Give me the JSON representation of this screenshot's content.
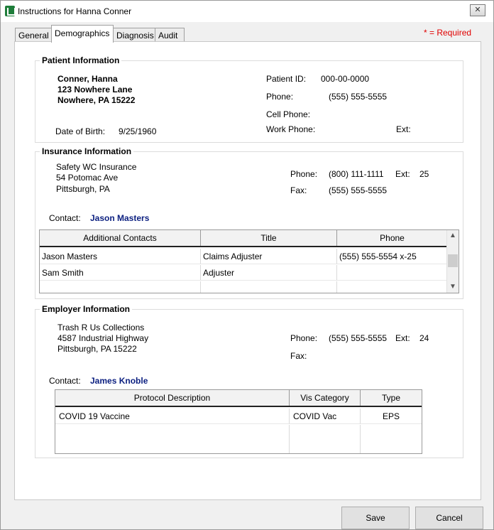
{
  "window": {
    "title": "Instructions for Hanna Conner",
    "close_symbol": "✕"
  },
  "tabs": [
    {
      "label": "General"
    },
    {
      "label": "Demographics"
    },
    {
      "label": "Diagnosis"
    },
    {
      "label": "Audit"
    }
  ],
  "required_note": "* = Required",
  "patient": {
    "title": "Patient Information",
    "name": "Conner, Hanna",
    "address1": "123 Nowhere Lane",
    "address2": "Nowhere, PA  15222",
    "dob_label": "Date of Birth:",
    "dob": "9/25/1960",
    "id_label": "Patient ID:",
    "id": "000-00-0000",
    "phone_label": "Phone:",
    "phone": "(555) 555-5555",
    "cell_label": "Cell Phone:",
    "work_label": "Work Phone:",
    "ext_label": "Ext:"
  },
  "insurance": {
    "title": "Insurance Information",
    "name": "Safety WC Insurance",
    "address1": "54 Potomac Ave",
    "address2": "Pittsburgh, PA",
    "phone_label": "Phone:",
    "phone": "(800) 111-1111",
    "ext_label": "Ext:",
    "ext": "25",
    "fax_label": "Fax:",
    "fax": "(555) 555-5555",
    "contact_label": "Contact:",
    "contact": "Jason Masters",
    "contacts_table": {
      "headers": [
        "Additional Contacts",
        "Title",
        "Phone"
      ],
      "rows": [
        [
          "Jason Masters",
          "Claims Adjuster",
          "(555) 555-5554  x-25"
        ],
        [
          "Sam Smith",
          "Adjuster",
          ""
        ]
      ]
    }
  },
  "employer": {
    "title": "Employer Information",
    "name": "Trash R Us Collections",
    "address1": "4587 Industrial Highway",
    "address2": "Pittsburgh, PA  15222",
    "phone_label": "Phone:",
    "phone": "(555) 555-5555",
    "ext_label": "Ext:",
    "ext": "24",
    "fax_label": "Fax:",
    "contact_label": "Contact:",
    "contact": "James Knoble",
    "protocol_table": {
      "headers": [
        "Protocol Description",
        "Vis Category",
        "Type"
      ],
      "rows": [
        [
          "COVID 19 Vaccine",
          "COVID Vac",
          "EPS"
        ]
      ]
    }
  },
  "buttons": {
    "save": "Save",
    "cancel": "Cancel"
  },
  "icons": {
    "scroll_up": "▲",
    "scroll_down": "▼"
  }
}
